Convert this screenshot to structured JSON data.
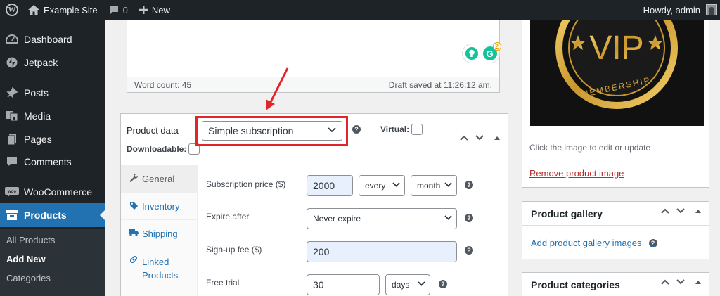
{
  "adminbar": {
    "site_name": "Example Site",
    "comments_count": "0",
    "new_label": "New",
    "howdy": "Howdy, admin"
  },
  "menu": {
    "items": [
      {
        "label": "Dashboard",
        "icon": "dashboard-icon"
      },
      {
        "label": "Jetpack",
        "icon": "jetpack-icon"
      },
      {
        "label": "Posts",
        "icon": "pin-icon"
      },
      {
        "label": "Media",
        "icon": "media-icon"
      },
      {
        "label": "Pages",
        "icon": "pages-icon"
      },
      {
        "label": "Comments",
        "icon": "comments-icon"
      },
      {
        "label": "WooCommerce",
        "icon": "woo-icon"
      },
      {
        "label": "Products",
        "icon": "archive-icon"
      }
    ],
    "submenu": [
      "All Products",
      "Add New",
      "Categories"
    ]
  },
  "editor": {
    "word_count": "Word count: 45",
    "draft_saved": "Draft saved at 11:26:12 am.",
    "grammarly_badge": "2"
  },
  "product_data": {
    "title": "Product data —",
    "type_selected": "Simple subscription",
    "virtual_label": "Virtual:",
    "downloadable_label": "Downloadable:",
    "tabs": [
      {
        "label": "General",
        "icon": "wrench-icon"
      },
      {
        "label": "Inventory",
        "icon": "tag-icon"
      },
      {
        "label": "Shipping",
        "icon": "truck-icon"
      },
      {
        "label_line1": "Linked",
        "label_line2": "Products",
        "icon": "link-icon"
      }
    ],
    "fields": {
      "price_label": "Subscription price ($)",
      "price_value": "2000",
      "every_value": "every",
      "period_value": "month",
      "expire_label": "Expire after",
      "expire_value": "Never expire",
      "signup_label": "Sign-up fee ($)",
      "signup_value": "200",
      "trial_label": "Free trial",
      "trial_value": "30",
      "trial_period": "days"
    }
  },
  "product_image": {
    "vip_text": "VIP",
    "membership_text": "MEMBERSHIP",
    "note": "Click the image to edit or update",
    "remove_link": "Remove product image"
  },
  "gallery": {
    "title": "Product gallery",
    "link": "Add product gallery images"
  },
  "categories": {
    "title": "Product categories"
  },
  "colors": {
    "adminbar_bg": "#1d2327",
    "menu_current": "#2271b1",
    "highlight_red": "#e2242b",
    "link_blue": "#2271b1"
  }
}
